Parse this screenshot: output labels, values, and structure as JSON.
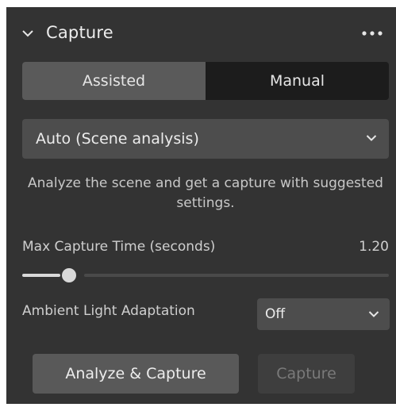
{
  "panel": {
    "title": "Capture",
    "collapse_icon": "chevron-down-icon",
    "more_icon": "more-horizontal-icon"
  },
  "mode_tabs": [
    {
      "label": "Assisted",
      "active": true
    },
    {
      "label": "Manual",
      "active": false
    }
  ],
  "capture_mode": {
    "selected": "Auto (Scene analysis)",
    "icon": "chevron-down-icon"
  },
  "description": "Analyze the scene and get a capture with suggested settings.",
  "max_capture_time": {
    "label": "Max Capture Time (seconds)",
    "value": "1.20"
  },
  "ambient_light": {
    "label": "Ambient Light Adaptation",
    "selected": "Off",
    "icon": "chevron-down-icon"
  },
  "buttons": {
    "analyze_capture": "Analyze & Capture",
    "capture": "Capture"
  },
  "colors": {
    "panel_bg": "#333333",
    "segment_bg": "#1c1c1c",
    "segment_active": "#5a5a5a",
    "control_bg": "#4d4d4d",
    "primary_button": "#595959",
    "disabled_text": "#7a7a7a"
  }
}
